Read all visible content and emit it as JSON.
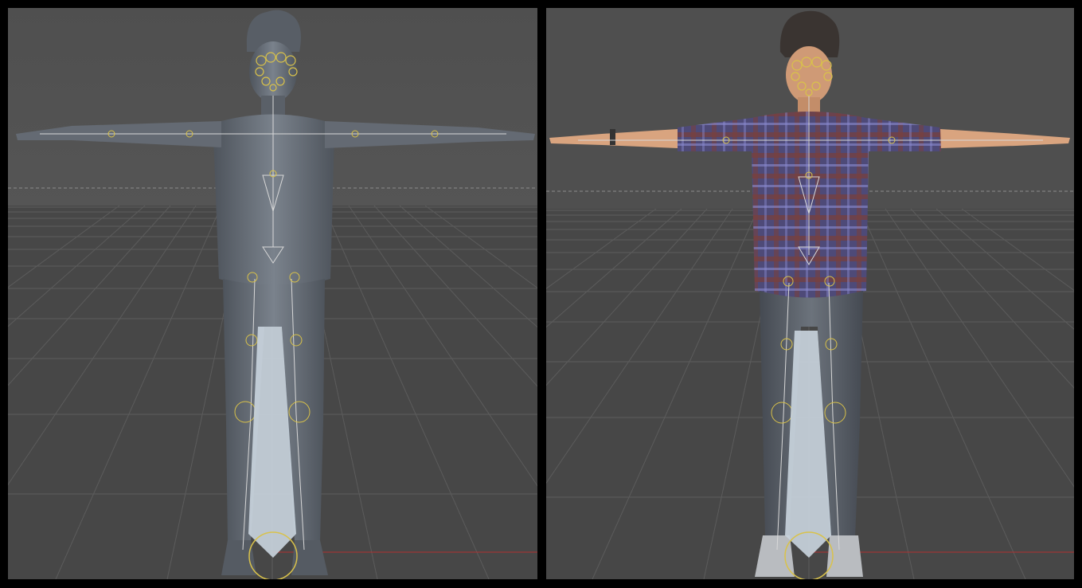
{
  "app": {
    "window_title": ""
  },
  "viewports": [
    {
      "id": "left",
      "shading": "untextured",
      "colors": {
        "sky": "#4d4d4d",
        "floor": "#484848",
        "grid": "#5a5a5a",
        "horizon_line": "#9a9a9a",
        "axis_x": "#b03030",
        "body": "#5f6670",
        "bone": "#d8d8d8",
        "joint": "#d9c24a",
        "spike": "#c8d2dc"
      },
      "objects": [
        "character",
        "skeleton-rig",
        "root-bone",
        "grid-floor"
      ]
    },
    {
      "id": "right",
      "shading": "textured",
      "colors": {
        "sky": "#4d4d4d",
        "floor": "#484848",
        "grid": "#5a5a5a",
        "horizon_line": "#9a9a9a",
        "axis_x": "#b03030",
        "skin": "#d9a47f",
        "hair": "#3a3431",
        "shirt": "#4e4a78",
        "shirt_check": "#7a3f3b",
        "pants": "#5c6168",
        "bone": "#d8d8d8",
        "joint": "#d9c24a",
        "spike": "#c8d2dc"
      },
      "objects": [
        "character",
        "skeleton-rig",
        "root-bone",
        "grid-floor"
      ]
    }
  ]
}
